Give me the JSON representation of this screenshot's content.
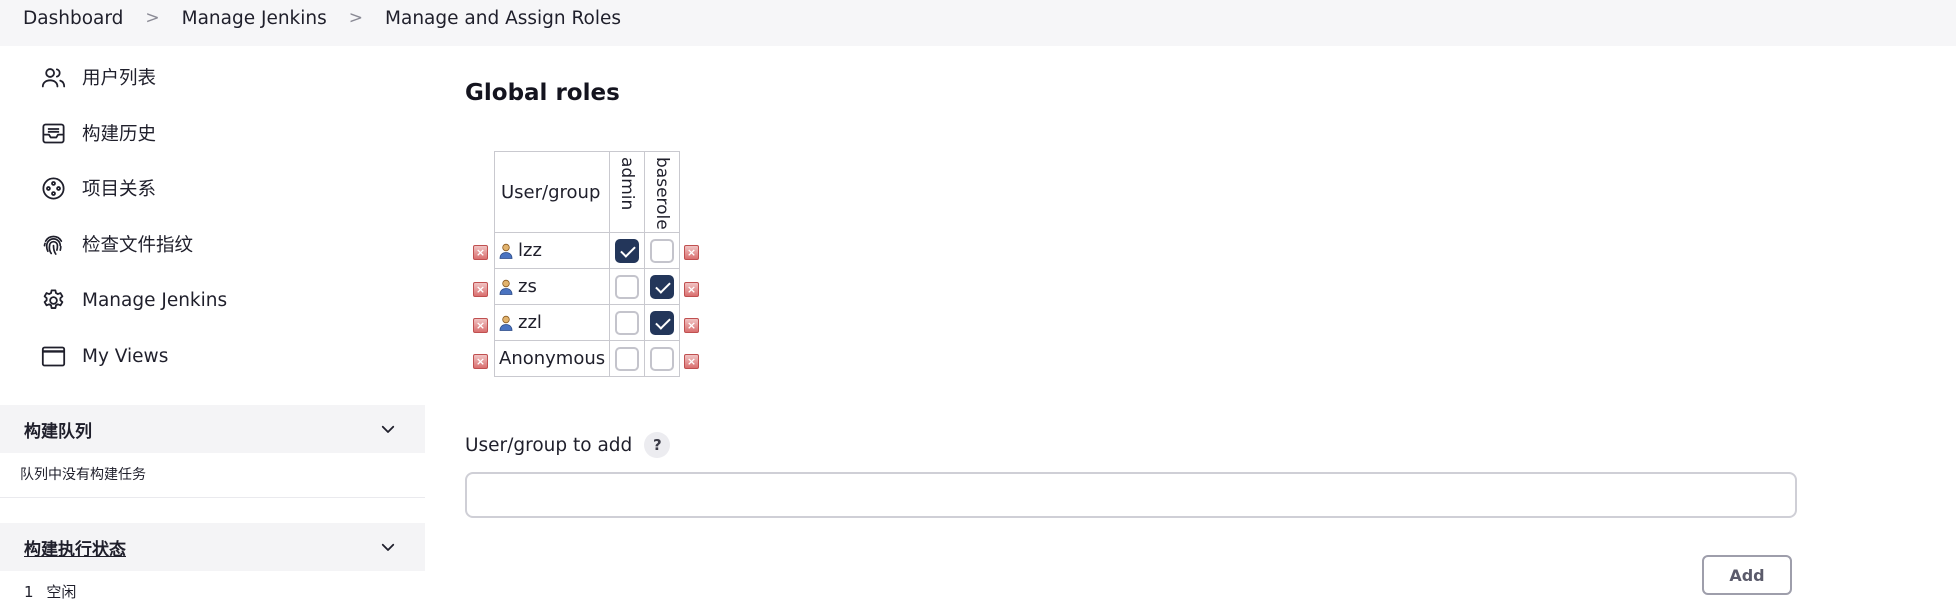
{
  "breadcrumb": {
    "items": [
      "Dashboard",
      "Manage Jenkins",
      "Manage and Assign Roles"
    ],
    "separator": ">"
  },
  "sidebar": {
    "items": [
      {
        "label": "用户列表",
        "icon": "people-icon"
      },
      {
        "label": "构建历史",
        "icon": "inbox-icon"
      },
      {
        "label": "项目关系",
        "icon": "relationship-icon"
      },
      {
        "label": "检查文件指纹",
        "icon": "fingerprint-icon"
      },
      {
        "label": "Manage Jenkins",
        "icon": "gear-icon"
      },
      {
        "label": "My Views",
        "icon": "window-icon"
      }
    ],
    "build_queue": {
      "title": "构建队列",
      "empty_text": "队列中没有构建任务"
    },
    "executor_status": {
      "title": "构建执行状态",
      "line_number": "1",
      "line_text": "空闲"
    }
  },
  "main": {
    "heading": "Global roles",
    "table": {
      "header_user_group": "User/group",
      "roles": [
        "admin",
        "baserole"
      ],
      "rows": [
        {
          "name": "lzz",
          "is_user": true,
          "checked": [
            true,
            false
          ]
        },
        {
          "name": "zs",
          "is_user": true,
          "checked": [
            false,
            true
          ]
        },
        {
          "name": "zzl",
          "is_user": true,
          "checked": [
            false,
            true
          ]
        },
        {
          "name": "Anonymous",
          "is_user": false,
          "checked": [
            false,
            false
          ]
        }
      ]
    },
    "add_label": "User/group to add",
    "help_glyph": "?",
    "add_input_value": "",
    "add_button_label": "Add"
  },
  "colors": {
    "checked": "#23365a",
    "delete": "#d96f6f",
    "sidebar_panel": "#f4f4f6"
  }
}
